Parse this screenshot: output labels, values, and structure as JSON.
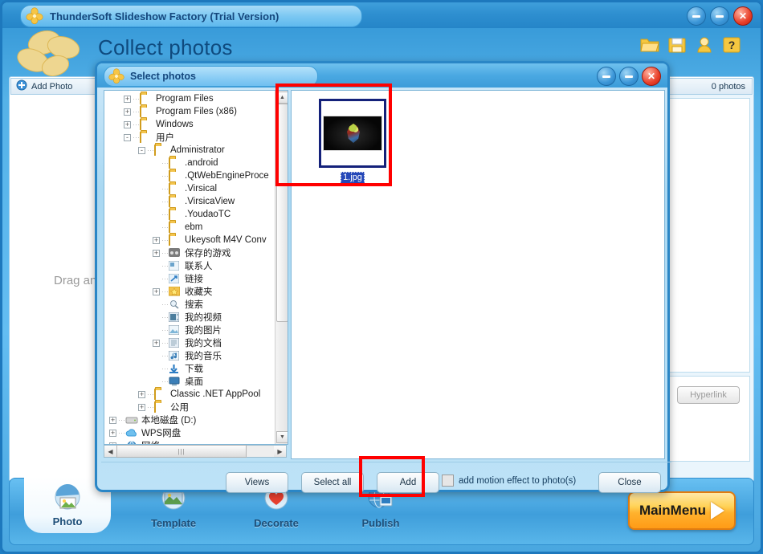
{
  "app": {
    "title": "ThunderSoft Slideshow Factory (Trial Version)",
    "page_title": "Collect photos",
    "logo_icon": "flower-logo-icon",
    "window_buttons": [
      {
        "name": "minimize-button",
        "icon": "minimize-icon"
      },
      {
        "name": "maximize-button",
        "icon": "maximize-icon"
      },
      {
        "name": "close-button",
        "icon": "close-icon"
      }
    ],
    "header_icons": [
      {
        "name": "open-project-icon",
        "label": "open-folder-icon"
      },
      {
        "name": "save-project-icon",
        "label": "save-disk-icon"
      },
      {
        "name": "account-icon",
        "label": "user-icon"
      },
      {
        "name": "help-icon",
        "label": "question-mark-icon"
      }
    ]
  },
  "left_panel": {
    "add_photo_label": "Add Photo",
    "add_photo_icon": "add-photo-icon",
    "photo_count_label": "0 photos",
    "drag_hint": "Drag an",
    "hyperlink_label": "Hyperlink"
  },
  "bottom_nav": {
    "items": [
      {
        "label": "Photo",
        "icon": "photo-icon",
        "active": true
      },
      {
        "label": "Template",
        "icon": "template-icon",
        "active": false
      },
      {
        "label": "Decorate",
        "icon": "heart-decorate-icon",
        "active": false
      },
      {
        "label": "Publish",
        "icon": "publish-globe-icon",
        "active": false
      }
    ],
    "main_menu_label": "MainMenu",
    "main_menu_icon": "play-arrow-icon"
  },
  "dialog": {
    "title": "Select photos",
    "logo_icon": "flower-logo-icon",
    "window_buttons": [
      {
        "name": "dialog-minimize-button",
        "icon": "minimize-icon"
      },
      {
        "name": "dialog-maximize-button",
        "icon": "maximize-icon"
      },
      {
        "name": "dialog-close-button",
        "icon": "close-icon"
      }
    ],
    "tree": [
      {
        "label": "Program Files",
        "indent": 1,
        "twisty": "+",
        "icon": "folder-icon"
      },
      {
        "label": "Program Files (x86)",
        "indent": 1,
        "twisty": "+",
        "icon": "folder-icon"
      },
      {
        "label": "Windows",
        "indent": 1,
        "twisty": "+",
        "icon": "folder-icon"
      },
      {
        "label": "用户",
        "indent": 1,
        "twisty": "-",
        "icon": "folder-icon"
      },
      {
        "label": "Administrator",
        "indent": 2,
        "twisty": "-",
        "icon": "folder-icon"
      },
      {
        "label": ".android",
        "indent": 3,
        "twisty": "",
        "icon": "folder-icon"
      },
      {
        "label": ".QtWebEngineProce",
        "indent": 3,
        "twisty": "",
        "icon": "folder-icon"
      },
      {
        "label": ".Virsical",
        "indent": 3,
        "twisty": "",
        "icon": "folder-icon"
      },
      {
        "label": ".VirsicaView",
        "indent": 3,
        "twisty": "",
        "icon": "folder-icon"
      },
      {
        "label": ".YoudaoTC",
        "indent": 3,
        "twisty": "",
        "icon": "folder-icon"
      },
      {
        "label": "ebm",
        "indent": 3,
        "twisty": "",
        "icon": "folder-icon"
      },
      {
        "label": "Ukeysoft M4V Conv",
        "indent": 3,
        "twisty": "+",
        "icon": "folder-icon"
      },
      {
        "label": "保存的游戏",
        "indent": 3,
        "twisty": "+",
        "icon": "saved-games-icon"
      },
      {
        "label": "联系人",
        "indent": 3,
        "twisty": "",
        "icon": "contacts-icon"
      },
      {
        "label": "链接",
        "indent": 3,
        "twisty": "",
        "icon": "links-icon"
      },
      {
        "label": "收藏夹",
        "indent": 3,
        "twisty": "+",
        "icon": "favorites-star-icon"
      },
      {
        "label": "搜索",
        "indent": 3,
        "twisty": "",
        "icon": "search-icon"
      },
      {
        "label": "我的视频",
        "indent": 3,
        "twisty": "",
        "icon": "my-videos-icon"
      },
      {
        "label": "我的图片",
        "indent": 3,
        "twisty": "",
        "icon": "my-pictures-icon"
      },
      {
        "label": "我的文档",
        "indent": 3,
        "twisty": "+",
        "icon": "my-documents-icon"
      },
      {
        "label": "我的音乐",
        "indent": 3,
        "twisty": "",
        "icon": "my-music-icon"
      },
      {
        "label": "下载",
        "indent": 3,
        "twisty": "",
        "icon": "downloads-icon"
      },
      {
        "label": "桌面",
        "indent": 3,
        "twisty": "",
        "icon": "desktop-icon"
      },
      {
        "label": "Classic .NET AppPool",
        "indent": 2,
        "twisty": "+",
        "icon": "folder-icon"
      },
      {
        "label": "公用",
        "indent": 2,
        "twisty": "+",
        "icon": "folder-icon"
      },
      {
        "label": "本地磁盘 (D:)",
        "indent": 0,
        "twisty": "+",
        "icon": "local-disk-icon"
      },
      {
        "label": "WPS网盘",
        "indent": 0,
        "twisty": "+",
        "icon": "cloud-drive-icon"
      },
      {
        "label": "网络",
        "indent": 0,
        "twisty": "+",
        "icon": "network-icon"
      }
    ],
    "thumbnail": {
      "filename": "1.jpg",
      "selected": true
    },
    "footer": {
      "views_label": "Views",
      "select_all_label": "Select all",
      "add_label": "Add",
      "motion_label": "add motion effect to photo(s)",
      "motion_checked": false,
      "close_label": "Close"
    }
  },
  "annotations": {
    "highlight_color": "#ff0000",
    "boxes": [
      {
        "name": "thumbnail-highlight-box"
      },
      {
        "name": "add-button-highlight-box"
      }
    ]
  }
}
